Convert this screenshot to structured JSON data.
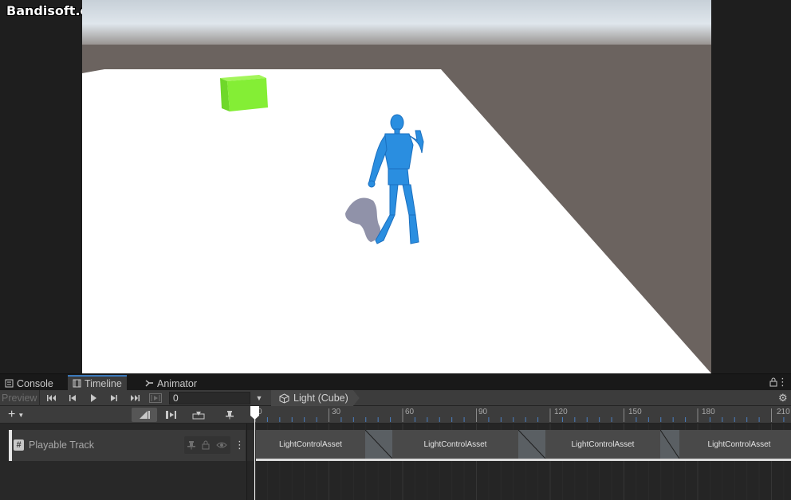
{
  "watermark": "Bandisoft.com",
  "tabs": [
    {
      "label": "Console",
      "icon": "console-icon"
    },
    {
      "label": "Timeline",
      "icon": "film-icon",
      "active": true
    },
    {
      "label": "Animator",
      "icon": "animator-icon"
    }
  ],
  "toolbar": {
    "preview_label": "Preview",
    "frame_value": "0",
    "breadcrumb_label": "Light (Cube)"
  },
  "ruler": {
    "labels": [
      "0",
      "30",
      "60",
      "90",
      "120",
      "150",
      "180",
      "210"
    ]
  },
  "track": {
    "name": "Playable Track",
    "icon": "hash-icon"
  },
  "clips": [
    {
      "label": "LightControlAsset"
    },
    {
      "label": "LightControlAsset"
    },
    {
      "label": "LightControlAsset"
    },
    {
      "label": "LightControlAsset"
    }
  ],
  "colors": {
    "accent": "#3a79bb",
    "clip": "#494949",
    "blend": "#5a5f63",
    "character": "#2a8ee0",
    "cube": "#7ef02a",
    "floor": "#ffffff",
    "ground": "#6b635f"
  }
}
